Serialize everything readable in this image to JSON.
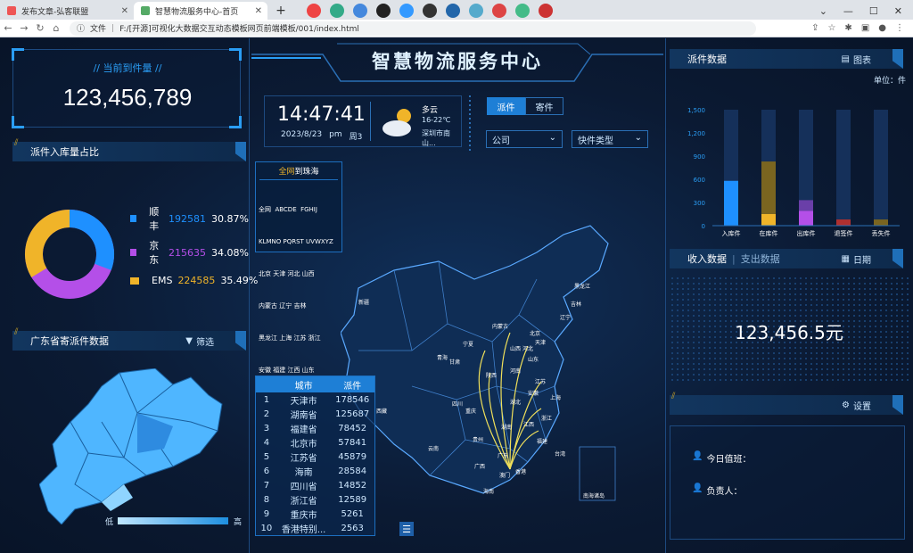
{
  "browser": {
    "tabs": [
      {
        "title": "发布文章-弘客联盟",
        "active": false
      },
      {
        "title": "智慧物流服务中心-首页",
        "active": true
      }
    ],
    "url_label": "文件",
    "url": "F:/[开源]可视化大数据交互动态模板网页前端模板/001/index.html"
  },
  "header": {
    "title": "智慧物流服务中心"
  },
  "left": {
    "arrive": {
      "label": "当前到件量",
      "value": "123,456,789"
    },
    "ratio": {
      "title": "派件入库量占比",
      "items": [
        {
          "name": "顺丰",
          "value": "192581",
          "pct": "30.87%",
          "color": "#1e90ff"
        },
        {
          "name": "京东",
          "value": "215635",
          "pct": "34.08%",
          "color": "#b44fe8"
        },
        {
          "name": "EMS",
          "value": "224585",
          "pct": "35.49%",
          "color": "#f0b429"
        }
      ]
    },
    "gd": {
      "title": "广东省寄派件数据",
      "filter": "筛选",
      "legend_low": "低",
      "legend_high": "高"
    }
  },
  "mid": {
    "time": "14:47:41",
    "date": "2023/8/23",
    "ampm": "pm",
    "weekday": "周3",
    "weather": {
      "cond": "多云",
      "temp": "16-22℃",
      "loc": "深圳市南山..."
    },
    "tabs": [
      "派件",
      "寄件"
    ],
    "select_company": "公司",
    "select_type": "快件类型",
    "region": {
      "title_a": "全网",
      "title_b": "到珠海",
      "rows": [
        "全网  ABCDE  FGHIJ",
        "KLMNO PQRST UVWXYZ",
        "北京 天津 河北 山西",
        "内蒙古 辽宁 吉林",
        "黑龙江 上海 江苏 浙江",
        "安徽 福建 江西 山东"
      ]
    },
    "table": {
      "headers": [
        "城市",
        "派件"
      ],
      "rows": [
        [
          "1",
          "天津市",
          "178546"
        ],
        [
          "2",
          "湖南省",
          "125687"
        ],
        [
          "3",
          "福建省",
          "78452"
        ],
        [
          "4",
          "北京市",
          "57841"
        ],
        [
          "5",
          "江苏省",
          "45879"
        ],
        [
          "6",
          "海南",
          "28584"
        ],
        [
          "7",
          "四川省",
          "14852"
        ],
        [
          "8",
          "浙江省",
          "12589"
        ],
        [
          "9",
          "重庆市",
          "5261"
        ],
        [
          "10",
          "香港特别...",
          "2563"
        ]
      ]
    },
    "map_labels": [
      "新疆",
      "西藏",
      "青海",
      "甘肃",
      "宁夏",
      "内蒙古",
      "黑龙江",
      "吉林",
      "辽宁",
      "北京",
      "天津",
      "河北",
      "山西",
      "山东",
      "陕西",
      "河南",
      "四川",
      "重庆",
      "湖北",
      "安徽",
      "江苏",
      "上海",
      "浙江",
      "湖南",
      "江西",
      "福建",
      "贵州",
      "云南",
      "广西",
      "广东",
      "台湾",
      "澳门",
      "香港",
      "海南",
      "南海诸岛"
    ]
  },
  "right": {
    "dispatch": {
      "title": "派件数据",
      "btn": "图表",
      "unit": "单位：件"
    },
    "income": {
      "tab_a": "收入数据",
      "tab_b": "支出数据",
      "btn": "日期",
      "value": "123,456.5元"
    },
    "settings": {
      "btn": "设置",
      "duty": "今日值班：",
      "owner": "负责人："
    }
  },
  "chart_data": {
    "type": "bar",
    "categories": [
      "入库件",
      "在库件",
      "出库件",
      "退签件",
      "丢失件"
    ],
    "series": [
      {
        "values": [
          580,
          830,
          330,
          80,
          80
        ]
      },
      {
        "values": [
          0,
          150,
          190,
          0,
          0
        ]
      }
    ],
    "yticks": [
      "0",
      "300",
      "600",
      "900",
      "1,200",
      "1,500"
    ],
    "ylim": [
      0,
      1500
    ]
  }
}
